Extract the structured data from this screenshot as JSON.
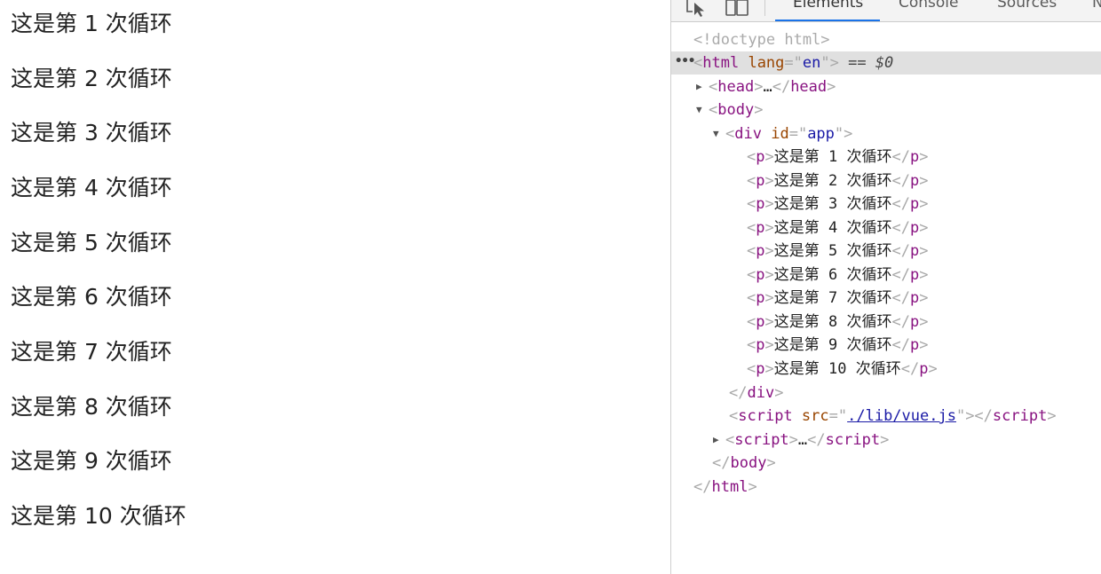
{
  "page": {
    "paragraphs": [
      "这是第 1 次循环",
      "这是第 2 次循环",
      "这是第 3 次循环",
      "这是第 4 次循环",
      "这是第 5 次循环",
      "这是第 6 次循环",
      "这是第 7 次循环",
      "这是第 8 次循环",
      "这是第 9 次循环",
      "这是第 10 次循环"
    ]
  },
  "devtools": {
    "tabs": [
      "Elements",
      "Console",
      "Sources",
      "N"
    ],
    "active_tab": "Elements",
    "icons": [
      "inspect-element-icon",
      "device-toolbar-icon"
    ],
    "accent": "#1a73e8",
    "tree": {
      "doctype": "<!doctype html>",
      "html_open_tag": "html",
      "html_attr_name": "lang",
      "html_attr_value": "en",
      "selected_marker": "== $0",
      "ellipsis_marker": "…",
      "head_tag": "head",
      "body_tag": "body",
      "div_tag": "div",
      "div_attr_name": "id",
      "div_attr_value": "app",
      "p_tag": "p",
      "p_items": [
        "这是第 1 次循环",
        "这是第 2 次循环",
        "这是第 3 次循环",
        "这是第 4 次循环",
        "这是第 5 次循环",
        "这是第 6 次循环",
        "这是第 7 次循环",
        "这是第 8 次循环",
        "这是第 9 次循环",
        "这是第 10 次循环"
      ],
      "script_tag": "script",
      "script_attr_name": "src",
      "script_attr_value": "./lib/vue.js"
    }
  }
}
